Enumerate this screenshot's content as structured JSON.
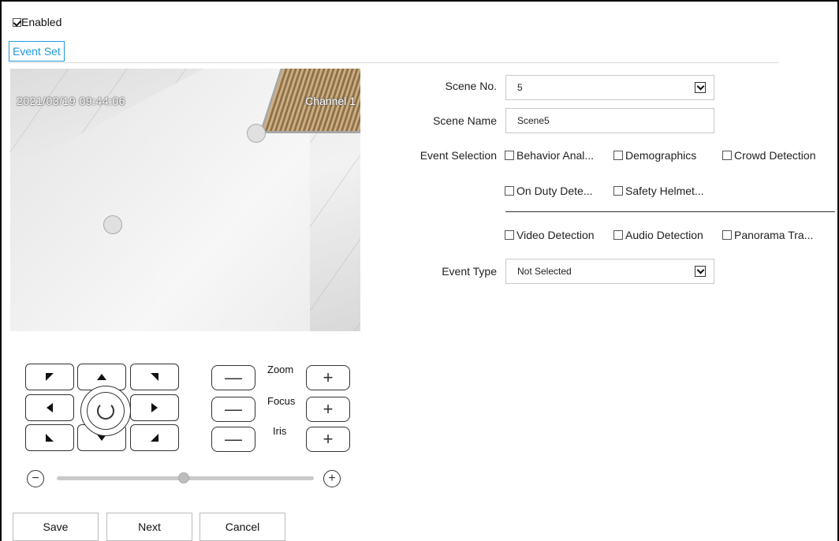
{
  "enabled": {
    "label": "Enabled",
    "checked": true
  },
  "tab": {
    "label": "Event Set"
  },
  "video": {
    "timestamp": "2021/03/19 09:44:06",
    "channel": "Channel 1"
  },
  "ptz": {
    "zoom_label": "Zoom",
    "focus_label": "Focus",
    "iris_label": "Iris",
    "minus": "—",
    "plus": "+",
    "slider_minus": "−",
    "slider_plus": "+",
    "slider_value": 0.5
  },
  "actions": {
    "save": "Save",
    "next": "Next",
    "cancel": "Cancel"
  },
  "form": {
    "scene_no_label": "Scene No.",
    "scene_no_value": "5",
    "scene_name_label": "Scene Name",
    "scene_name_value": "Scene5",
    "event_selection_label": "Event Selection",
    "event_options": [
      "Behavior Anal...",
      "Demographics",
      "Crowd Detection",
      "On Duty Dete...",
      "Safety Helmet...",
      "Video Detection",
      "Audio Detection",
      "Panorama Tra..."
    ],
    "event_type_label": "Event Type",
    "event_type_value": "Not Selected"
  }
}
